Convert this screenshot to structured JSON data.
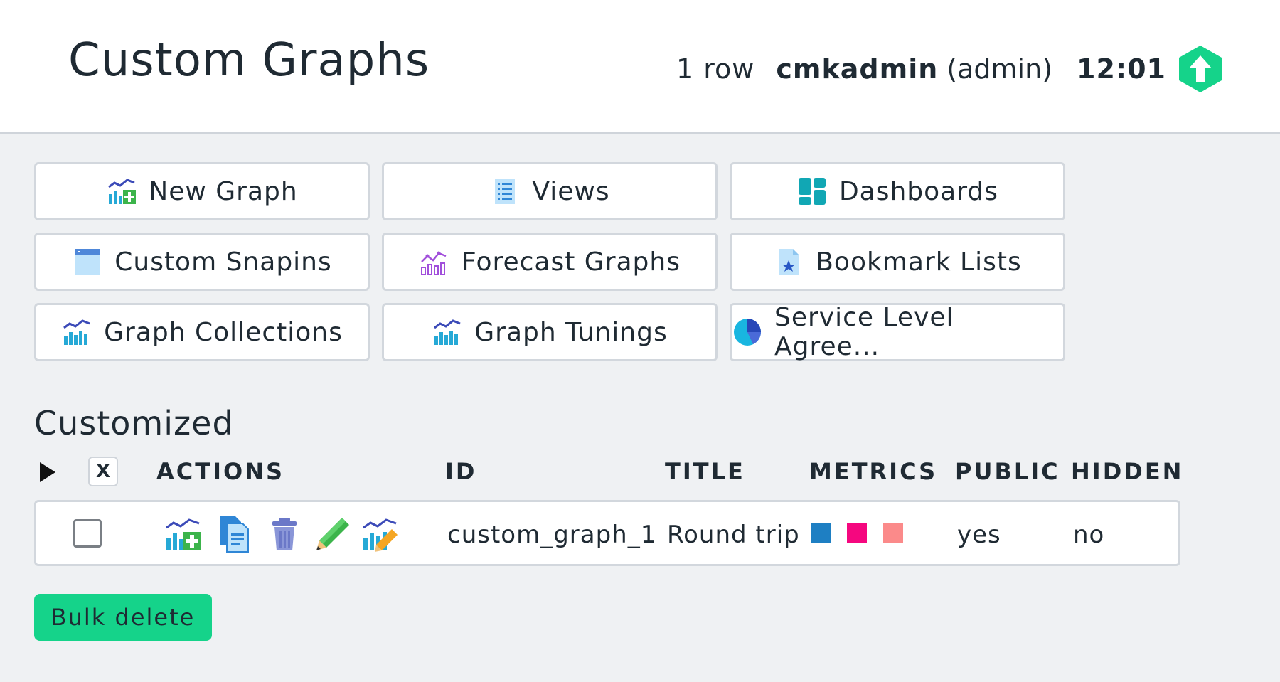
{
  "header": {
    "title": "Custom Graphs",
    "row_count": "1 row",
    "user_name": "cmkadmin",
    "user_role": "(admin)",
    "clock": "12:01"
  },
  "buttons": [
    {
      "label": "New Graph",
      "icon": "new-graph-icon"
    },
    {
      "label": "Views",
      "icon": "list-view-icon"
    },
    {
      "label": "Dashboards",
      "icon": "dashboard-icon"
    },
    {
      "label": "Custom Snapins",
      "icon": "snapin-icon"
    },
    {
      "label": "Forecast Graphs",
      "icon": "forecast-graph-icon"
    },
    {
      "label": "Bookmark Lists",
      "icon": "bookmark-icon"
    },
    {
      "label": "Graph Collections",
      "icon": "graph-collection-icon"
    },
    {
      "label": "Graph Tunings",
      "icon": "graph-tuning-icon"
    },
    {
      "label": "Service Level Agree...",
      "icon": "pie-chart-icon"
    }
  ],
  "section": {
    "title": "Customized",
    "clear_label": "X",
    "columns": {
      "actions": "ACTIONS",
      "id": "ID",
      "title": "TITLE",
      "metrics": "METRICS",
      "public": "PUBLIC",
      "hidden": "HIDDEN"
    }
  },
  "rows": [
    {
      "id": "custom_graph_1",
      "title": "Round trip",
      "metric_colors": [
        "#1e7fc3",
        "#f5077f",
        "#fb8a8a"
      ],
      "public": "yes",
      "hidden": "no"
    }
  ],
  "bulk_delete_label": "Bulk delete",
  "colors": {
    "accent_green": "#15d38a",
    "background": "#eff1f3"
  }
}
